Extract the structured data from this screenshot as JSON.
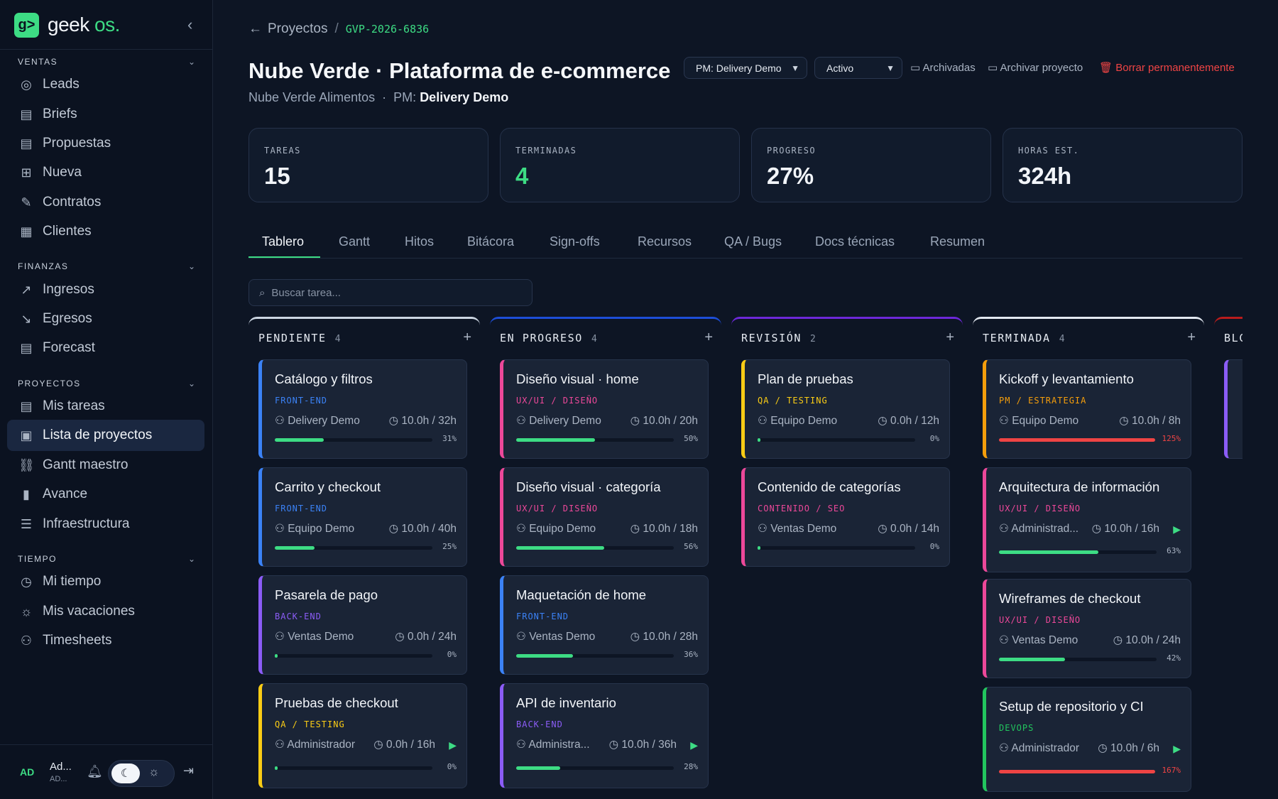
{
  "brand": {
    "name": "geek",
    "suffix": "os.",
    "logo": "g>"
  },
  "sidebar": {
    "sections": [
      {
        "title": "VENTAS",
        "items": [
          {
            "label": "Leads",
            "icon": "◎"
          },
          {
            "label": "Briefs",
            "icon": "▤"
          },
          {
            "label": "Propuestas",
            "icon": "▤"
          },
          {
            "label": "Nueva",
            "icon": "⊞"
          },
          {
            "label": "Contratos",
            "icon": "✎"
          },
          {
            "label": "Clientes",
            "icon": "▦"
          }
        ]
      },
      {
        "title": "FINANZAS",
        "items": [
          {
            "label": "Ingresos",
            "icon": "↗"
          },
          {
            "label": "Egresos",
            "icon": "↘"
          },
          {
            "label": "Forecast",
            "icon": "▤"
          }
        ]
      },
      {
        "title": "PROYECTOS",
        "items": [
          {
            "label": "Mis tareas",
            "icon": "▤"
          },
          {
            "label": "Lista de proyectos",
            "icon": "▣",
            "active": true
          },
          {
            "label": "Gantt maestro",
            "icon": "⛓"
          },
          {
            "label": "Avance",
            "icon": "▮"
          },
          {
            "label": "Infraestructura",
            "icon": "☰"
          }
        ]
      },
      {
        "title": "TIEMPO",
        "items": [
          {
            "label": "Mi tiempo",
            "icon": "◷"
          },
          {
            "label": "Mis vacaciones",
            "icon": "☼"
          },
          {
            "label": "Timesheets",
            "icon": "⚇"
          }
        ]
      }
    ],
    "user": {
      "initials": "AD",
      "name": "Ad...",
      "role": "AD..."
    }
  },
  "breadcrumb": {
    "parent": "Proyectos",
    "separator": "/",
    "code": "GVP-2026-6836"
  },
  "project": {
    "title": "Nube Verde · Plataforma de e-commerce",
    "client": "Nube Verde Alimentos",
    "pm_label": "PM:",
    "pm_name": "Delivery Demo"
  },
  "header_controls": {
    "pm_select": "PM: Delivery Demo",
    "status_select": "Activo",
    "archived": "Archivadas",
    "archive": "Archivar proyecto",
    "delete": "Borrar permanentemente"
  },
  "kpis": [
    {
      "label": "TAREAS",
      "value": "15"
    },
    {
      "label": "TERMINADAS",
      "value": "4",
      "accent": "#3ddc84"
    },
    {
      "label": "PROGRESO",
      "value": "27%"
    },
    {
      "label": "HORAS EST.",
      "value": "324h"
    }
  ],
  "tabs": [
    "Tablero",
    "Gantt",
    "Hitos",
    "Bitácora",
    "Sign-offs",
    "Recursos",
    "QA / Bugs",
    "Docs técnicas",
    "Resumen"
  ],
  "active_tab": "Tablero",
  "search": {
    "placeholder": "Buscar tarea..."
  },
  "colors": {
    "accent": "#3ddc84",
    "danger": "#ef4444",
    "front_end": "#3b82f6",
    "ux_ui": "#ec4899",
    "back_end": "#8b5cf6",
    "qa": "#facc15",
    "pm": "#f59e0b",
    "devops": "#22c55e"
  },
  "columns": [
    {
      "title": "PENDIENTE",
      "count": "4",
      "border": "#cbd5e1",
      "cards": [
        {
          "title": "Catálogo y filtros",
          "category": "FRONT-END",
          "cat_color": "#3b82f6",
          "assignee": "Delivery Demo",
          "hours": "10.0h / 32h",
          "progress": 31,
          "pct_label": "31%"
        },
        {
          "title": "Carrito y checkout",
          "category": "FRONT-END",
          "cat_color": "#3b82f6",
          "assignee": "Equipo Demo",
          "hours": "10.0h / 40h",
          "progress": 25,
          "pct_label": "25%"
        },
        {
          "title": "Pasarela de pago",
          "category": "BACK-END",
          "cat_color": "#8b5cf6",
          "assignee": "Ventas Demo",
          "hours": "0.0h / 24h",
          "progress": 0,
          "pct_label": "0%"
        },
        {
          "title": "Pruebas de checkout",
          "category": "QA / TESTING",
          "cat_color": "#facc15",
          "assignee": "Administrador",
          "hours": "0.0h / 16h",
          "progress": 0,
          "pct_label": "0%",
          "running": true
        }
      ]
    },
    {
      "title": "EN PROGRESO",
      "count": "4",
      "border": "#1d4ed8",
      "cards": [
        {
          "title": "Diseño visual · home",
          "category": "UX/UI / DISEÑO",
          "cat_color": "#ec4899",
          "assignee": "Delivery Demo",
          "hours": "10.0h / 20h",
          "progress": 50,
          "pct_label": "50%"
        },
        {
          "title": "Diseño visual · categoría",
          "category": "UX/UI / DISEÑO",
          "cat_color": "#ec4899",
          "assignee": "Equipo Demo",
          "hours": "10.0h / 18h",
          "progress": 56,
          "pct_label": "56%"
        },
        {
          "title": "Maquetación de home",
          "category": "FRONT-END",
          "cat_color": "#3b82f6",
          "assignee": "Ventas Demo",
          "hours": "10.0h / 28h",
          "progress": 36,
          "pct_label": "36%"
        },
        {
          "title": "API de inventario",
          "category": "BACK-END",
          "cat_color": "#8b5cf6",
          "assignee": "Administra...",
          "hours": "10.0h / 36h",
          "progress": 28,
          "pct_label": "28%",
          "running": true
        }
      ]
    },
    {
      "title": "REVISIÓN",
      "count": "2",
      "border": "#6d28d9",
      "cards": [
        {
          "title": "Plan de pruebas",
          "category": "QA / TESTING",
          "cat_color": "#facc15",
          "assignee": "Equipo Demo",
          "hours": "0.0h / 12h",
          "progress": 0,
          "pct_label": "0%"
        },
        {
          "title": "Contenido de categorías",
          "category": "CONTENIDO / SEO",
          "cat_color": "#ec4899",
          "assignee": "Ventas Demo",
          "hours": "0.0h / 14h",
          "progress": 0,
          "pct_label": "0%"
        }
      ]
    },
    {
      "title": "TERMINADA",
      "count": "4",
      "border": "#e2e8f0",
      "cards": [
        {
          "title": "Kickoff y levantamiento",
          "category": "PM / ESTRATEGIA",
          "cat_color": "#f59e0b",
          "assignee": "Equipo Demo",
          "hours": "10.0h / 8h",
          "progress": 125,
          "pct_label": "125%",
          "over": true
        },
        {
          "title": "Arquitectura de información",
          "category": "UX/UI / DISEÑO",
          "cat_color": "#ec4899",
          "assignee": "Administrad...",
          "hours": "10.0h / 16h",
          "progress": 63,
          "pct_label": "63%",
          "running": true
        },
        {
          "title": "Wireframes de checkout",
          "category": "UX/UI / DISEÑO",
          "cat_color": "#ec4899",
          "assignee": "Ventas Demo",
          "hours": "10.0h / 24h",
          "progress": 42,
          "pct_label": "42%"
        },
        {
          "title": "Setup de repositorio y CI",
          "category": "DEVOPS",
          "cat_color": "#22c55e",
          "assignee": "Administrador",
          "hours": "10.0h / 6h",
          "progress": 167,
          "pct_label": "167%",
          "over": true,
          "running": true
        }
      ]
    },
    {
      "title": "BLC",
      "count": "",
      "border": "#b91c1c",
      "cards": [
        {
          "title": "",
          "category": "",
          "cat_color": "#8b5cf6",
          "assignee": "",
          "hours": "",
          "progress": 0,
          "pct_label": ""
        }
      ]
    }
  ]
}
